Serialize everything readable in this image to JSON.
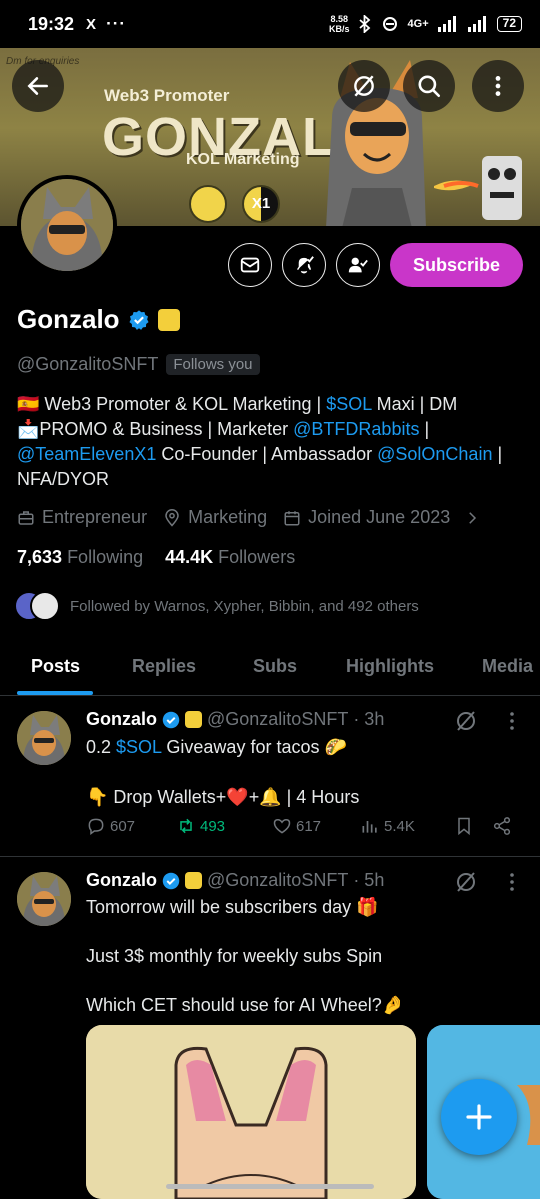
{
  "status_bar": {
    "time": "19:32",
    "app_badge": "X",
    "dots": "···",
    "speed_top": "8.58",
    "speed_bottom": "KB/s",
    "network": "4G+",
    "battery": "72"
  },
  "banner": {
    "tag_text": "Dm for enquiries",
    "line1": "Web3 Promoter",
    "line2": "GONZALO",
    "line3": "KOL Marketing",
    "coin2_text": "X1"
  },
  "profile": {
    "name": "Gonzalo",
    "handle": "@GonzalitoSNFT",
    "follows_you": "Follows you",
    "subscribe_label": "Subscribe",
    "bio": {
      "l1_a": "🇪🇸 Web3 Promoter & KOL Marketing | ",
      "l1_link": "$SOL",
      "l1_b": " Maxi | DM",
      "l2_a": "📩PROMO & Business | Marketer ",
      "l2_link": "@BTFDRabbits",
      "l2_b": " |",
      "l3_link1": "@TeamElevenX1",
      "l3_a": " Co-Founder | Ambassador ",
      "l3_link2": "@SolOnChain",
      "l3_b": " |",
      "l4": "NFA/DYOR"
    },
    "category": "Entrepreneur",
    "location": "Marketing",
    "joined": "Joined June 2023",
    "following_count": "7,633",
    "following_label": "Following",
    "followers_count": "44.4K",
    "followers_label": "Followers",
    "followed_by": "Followed by Warnos, Xypher, Bibbin, and 492 others"
  },
  "tabs": [
    {
      "label": "Posts",
      "active": true
    },
    {
      "label": "Replies",
      "active": false
    },
    {
      "label": "Subs",
      "active": false
    },
    {
      "label": "Highlights",
      "active": false
    },
    {
      "label": "Media",
      "active": false
    }
  ],
  "posts": [
    {
      "name": "Gonzalo",
      "handle": "@GonzalitoSNFT",
      "time": "· 3h",
      "line1_a": "0.2 ",
      "line1_link": "$SOL",
      "line1_b": " Giveaway for tacos 🌮",
      "line2": "👇 Drop Wallets+❤️+🔔 | 4 Hours",
      "replies": "607",
      "reposts": "493",
      "likes": "617",
      "views": "5.4K"
    },
    {
      "name": "Gonzalo",
      "handle": "@GonzalitoSNFT",
      "time": "· 5h",
      "line1": "Tomorrow will be subscribers day 🎁",
      "line2": "Just 3$ monthly for weekly subs Spin",
      "line3": "Which CET should use for AI Wheel?🤌"
    }
  ],
  "colors": {
    "accent": "#1d9bf0",
    "subscribe": "#c936c9",
    "repost_active": "#00ba7c",
    "background": "#000000"
  }
}
